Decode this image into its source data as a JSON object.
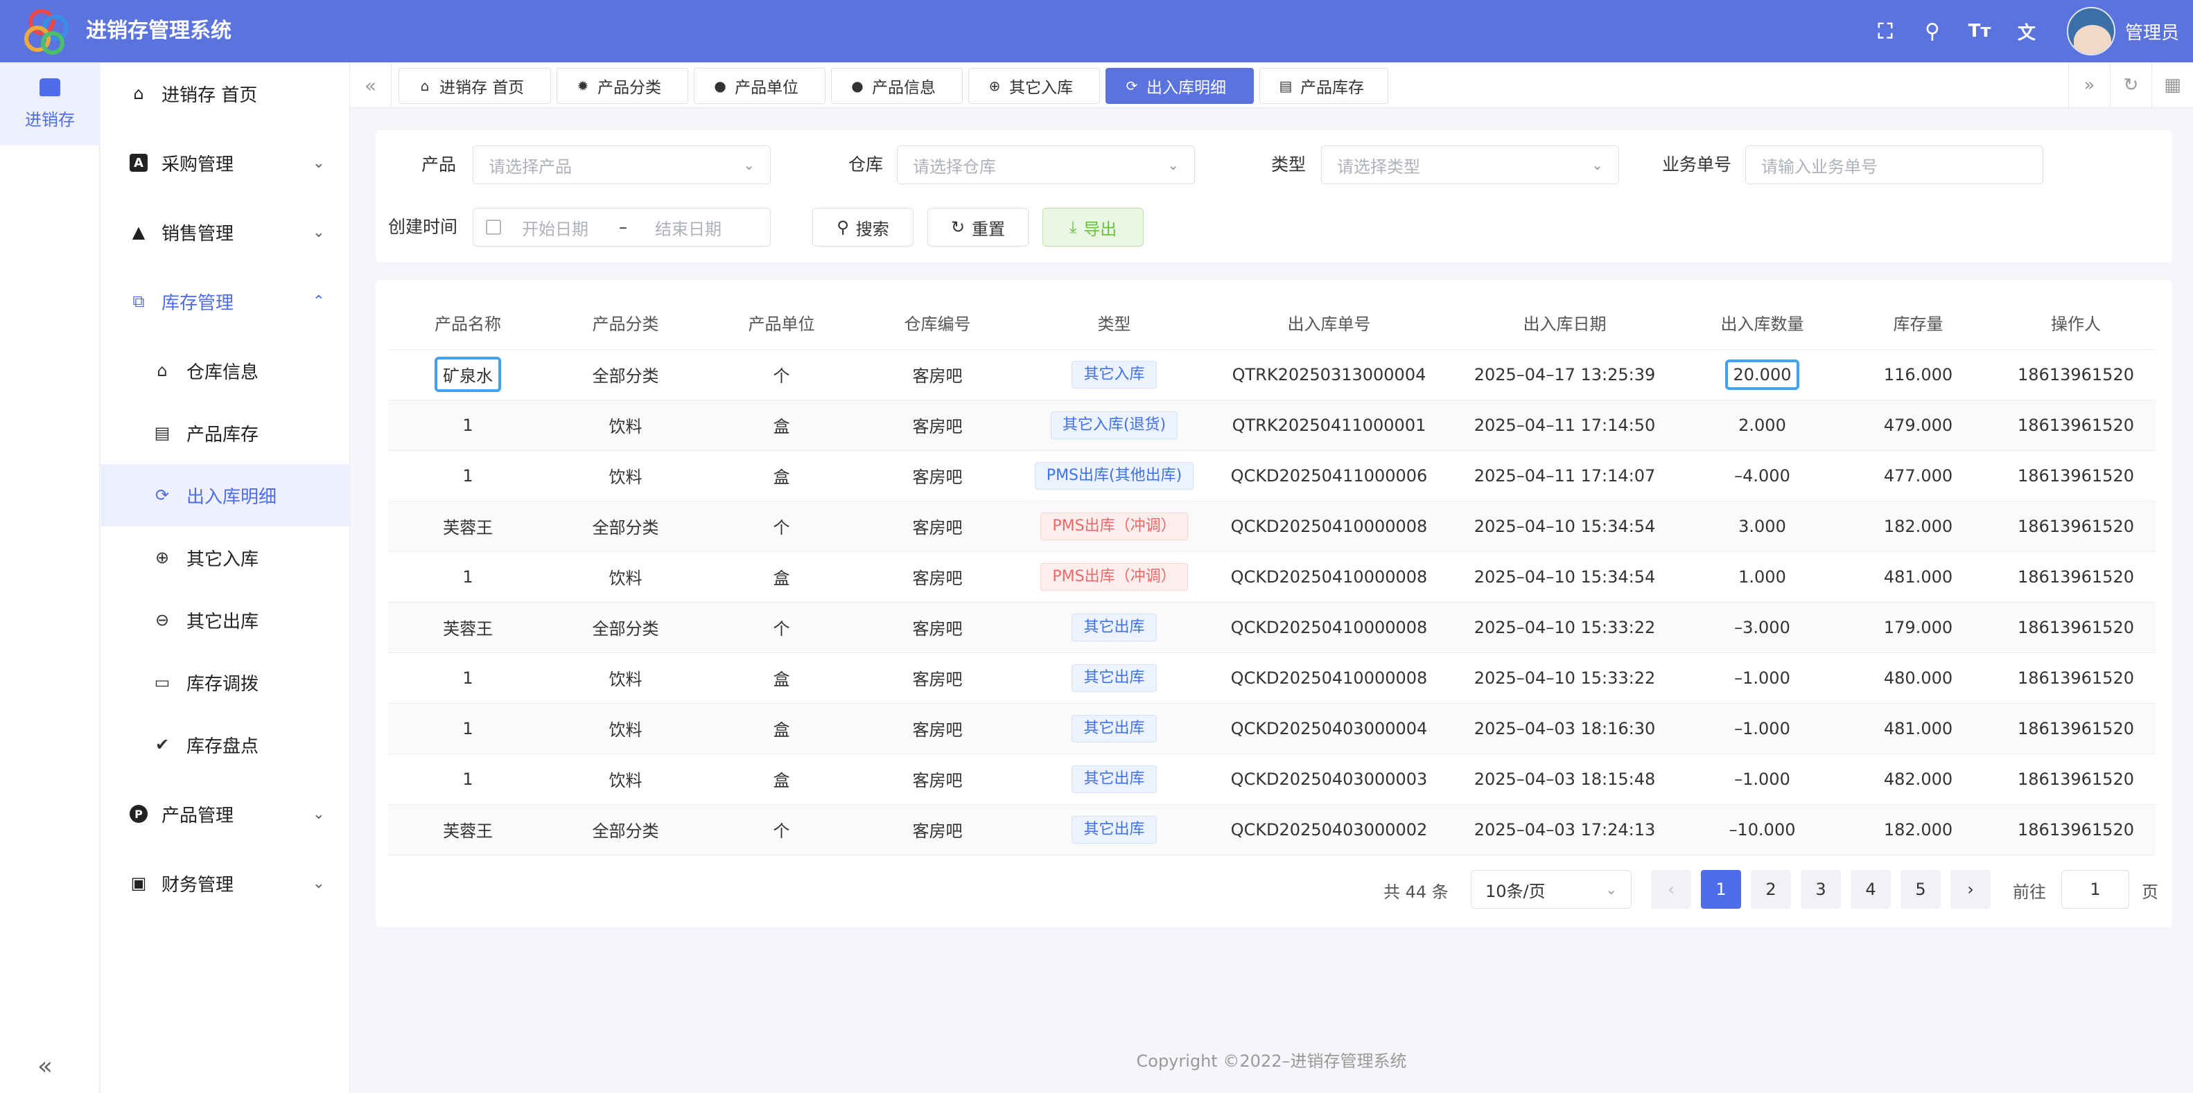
{
  "app": {
    "title": "进销存管理系统",
    "user": "管理员"
  },
  "header_icons": [
    "fullscreen-icon",
    "search-icon",
    "font-size-icon",
    "translate-icon"
  ],
  "rail": {
    "label": "进销存"
  },
  "menu": {
    "home": "进销存 首页",
    "purchase": "采购管理",
    "sales": "销售管理",
    "inventory": "库存管理",
    "inventory_children": [
      "仓库信息",
      "产品库存",
      "出入库明细",
      "其它入库",
      "其它出库",
      "库存调拨",
      "库存盘点"
    ],
    "product": "产品管理",
    "finance": "财务管理"
  },
  "tabs": [
    "进销存 首页",
    "产品分类",
    "产品单位",
    "产品信息",
    "其它入库",
    "出入库明细",
    "产品库存"
  ],
  "filters": {
    "product_label": "产品",
    "product_placeholder": "请选择产品",
    "warehouse_label": "仓库",
    "warehouse_placeholder": "请选择仓库",
    "type_label": "类型",
    "type_placeholder": "请选择类型",
    "biz_label": "业务单号",
    "biz_placeholder": "请输入业务单号",
    "created_label": "创建时间",
    "start_placeholder": "开始日期",
    "range_sep": "–",
    "end_placeholder": "结束日期",
    "search_btn": "搜索",
    "reset_btn": "重置",
    "export_btn": "导出"
  },
  "table": {
    "headers": [
      "产品名称",
      "产品分类",
      "产品单位",
      "仓库编号",
      "类型",
      "出入库单号",
      "出入库日期",
      "出入库数量",
      "库存量",
      "操作人"
    ],
    "rows": [
      {
        "name": "矿泉水",
        "category": "全部分类",
        "unit": "个",
        "warehouse": "客房吧",
        "type": "其它入库",
        "type_color": "blue",
        "order": "QTRK20250313000004",
        "date": "2025–04–17 13:25:39",
        "qty": "20.000",
        "stock": "116.000",
        "operator": "18613961520"
      },
      {
        "name": "1",
        "category": "饮料",
        "unit": "盒",
        "warehouse": "客房吧",
        "type": "其它入库(退货)",
        "type_color": "blue",
        "order": "QTRK20250411000001",
        "date": "2025–04–11 17:14:50",
        "qty": "2.000",
        "stock": "479.000",
        "operator": "18613961520"
      },
      {
        "name": "1",
        "category": "饮料",
        "unit": "盒",
        "warehouse": "客房吧",
        "type": "PMS出库(其他出库)",
        "type_color": "blue",
        "order": "QCKD20250411000006",
        "date": "2025–04–11 17:14:07",
        "qty": "–4.000",
        "stock": "477.000",
        "operator": "18613961520"
      },
      {
        "name": "芙蓉王",
        "category": "全部分类",
        "unit": "个",
        "warehouse": "客房吧",
        "type": "PMS出库（冲调）",
        "type_color": "red",
        "order": "QCKD20250410000008",
        "date": "2025–04–10 15:34:54",
        "qty": "3.000",
        "stock": "182.000",
        "operator": "18613961520"
      },
      {
        "name": "1",
        "category": "饮料",
        "unit": "盒",
        "warehouse": "客房吧",
        "type": "PMS出库（冲调）",
        "type_color": "red",
        "order": "QCKD20250410000008",
        "date": "2025–04–10 15:34:54",
        "qty": "1.000",
        "stock": "481.000",
        "operator": "18613961520"
      },
      {
        "name": "芙蓉王",
        "category": "全部分类",
        "unit": "个",
        "warehouse": "客房吧",
        "type": "其它出库",
        "type_color": "blue",
        "order": "QCKD20250410000008",
        "date": "2025–04–10 15:33:22",
        "qty": "–3.000",
        "stock": "179.000",
        "operator": "18613961520"
      },
      {
        "name": "1",
        "category": "饮料",
        "unit": "盒",
        "warehouse": "客房吧",
        "type": "其它出库",
        "type_color": "blue",
        "order": "QCKD20250410000008",
        "date": "2025–04–10 15:33:22",
        "qty": "–1.000",
        "stock": "480.000",
        "operator": "18613961520"
      },
      {
        "name": "1",
        "category": "饮料",
        "unit": "盒",
        "warehouse": "客房吧",
        "type": "其它出库",
        "type_color": "blue",
        "order": "QCKD20250403000004",
        "date": "2025–04–03 18:16:30",
        "qty": "–1.000",
        "stock": "481.000",
        "operator": "18613961520"
      },
      {
        "name": "1",
        "category": "饮料",
        "unit": "盒",
        "warehouse": "客房吧",
        "type": "其它出库",
        "type_color": "blue",
        "order": "QCKD20250403000003",
        "date": "2025–04–03 18:15:48",
        "qty": "–1.000",
        "stock": "482.000",
        "operator": "18613961520"
      },
      {
        "name": "芙蓉王",
        "category": "全部分类",
        "unit": "个",
        "warehouse": "客房吧",
        "type": "其它出库",
        "type_color": "blue",
        "order": "QCKD20250403000002",
        "date": "2025–04–03 17:24:13",
        "qty": "–10.000",
        "stock": "182.000",
        "operator": "18613961520"
      }
    ]
  },
  "pagination": {
    "total": "共 44 条",
    "page_size": "10条/页",
    "pages": [
      "1",
      "2",
      "3",
      "4",
      "5"
    ],
    "current": "1",
    "goto_label": "前往",
    "goto_value": "1",
    "page_suffix": "页"
  },
  "footer": "Copyright ©2022–进销存管理系统",
  "colors": {
    "header": "#5b73dc",
    "accent": "#4f6de8",
    "highlight_border": "#42a2f2"
  }
}
